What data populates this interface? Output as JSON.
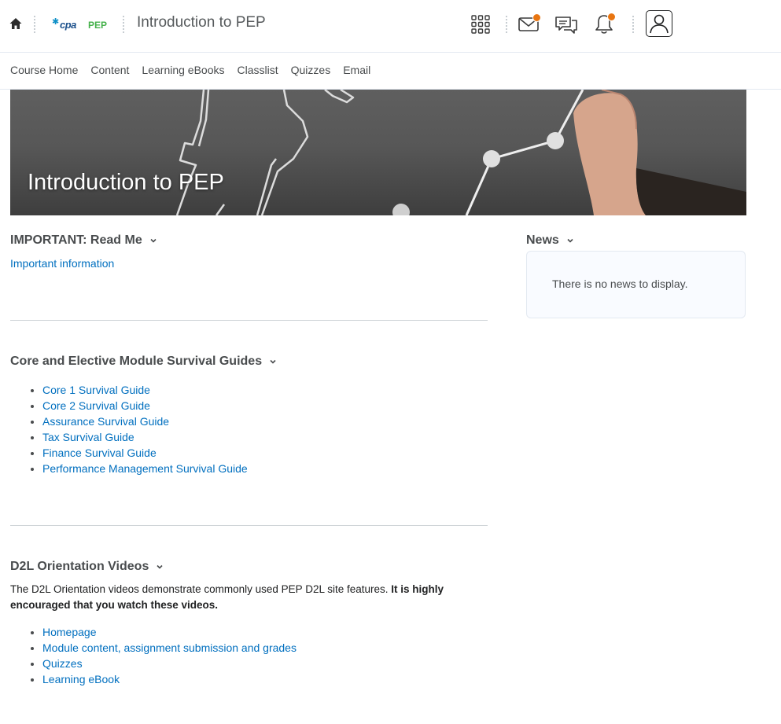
{
  "header": {
    "logo_text": "cpa",
    "logo_suffix": "PEP",
    "course_title": "Introduction to PEP",
    "icons": [
      "home-icon",
      "waffle-icon",
      "mail-icon",
      "chat-icon",
      "bell-icon",
      "user-icon"
    ]
  },
  "nav": {
    "items": [
      "Course Home",
      "Content",
      "Learning eBooks",
      "Classlist",
      "Quizzes",
      "Email"
    ]
  },
  "banner": {
    "title": "Introduction to PEP"
  },
  "important": {
    "title": "IMPORTANT: Read Me",
    "link": "Important information"
  },
  "guides": {
    "title": "Core and Elective Module Survival Guides",
    "items": [
      "Core 1 Survival Guide",
      "Core 2 Survival Guide",
      "Assurance Survival Guide",
      "Tax Survival Guide",
      "Finance Survival Guide",
      "Performance Management Survival Guide"
    ]
  },
  "orientation": {
    "title": "D2L Orientation Videos",
    "text_normal": "The D2L Orientation videos demonstrate commonly used PEP D2L site features. ",
    "text_bold": "It is highly encouraged that you watch these videos.",
    "items": [
      "Homepage",
      "Module content, assignment submission and grades",
      "Quizzes",
      "Learning eBook"
    ]
  },
  "news": {
    "title": "News",
    "empty_text": "There is no news to display."
  },
  "colors": {
    "link": "#006fbf",
    "badge": "#e87511",
    "logo_blue": "#1a4f8b",
    "logo_green": "#44b14a"
  }
}
